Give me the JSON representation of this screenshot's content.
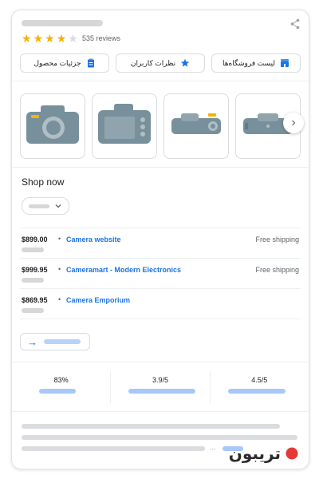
{
  "header": {
    "rating_value": 4,
    "rating_max": 5,
    "reviews_text": "535 reviews"
  },
  "actions": [
    {
      "label": "لیست فروشگاه‌ها",
      "icon": "store-icon"
    },
    {
      "label": "نظرات کاربران",
      "icon": "review-star-icon"
    },
    {
      "label": "جزئیات محصول",
      "icon": "clipboard-icon"
    }
  ],
  "thumbnails": [
    {
      "icon": "camera-front-icon"
    },
    {
      "icon": "camera-back-icon"
    },
    {
      "icon": "camera-top-icon"
    },
    {
      "icon": "camera-side-icon"
    }
  ],
  "shop": {
    "heading": "Shop now",
    "offers": [
      {
        "price": "$899.00",
        "store": "Camera website",
        "shipping": "Free shipping"
      },
      {
        "price": "$999.95",
        "store": "Cameramart - Modern Electronics",
        "shipping": "Free shipping"
      },
      {
        "price": "$869.95",
        "store": "Camera Emporium",
        "shipping": ""
      }
    ],
    "separator": "•"
  },
  "stats": [
    "83%",
    "3.9/5",
    "4.5/5"
  ],
  "bottom": {
    "ellipsis": "..."
  },
  "brand": {
    "text": "تریبون"
  },
  "colors": {
    "accent": "#1a73e8",
    "star": "#f6b100",
    "skeleton": "#d7d7d7",
    "skeleton_blue": "#a8c7fa"
  }
}
